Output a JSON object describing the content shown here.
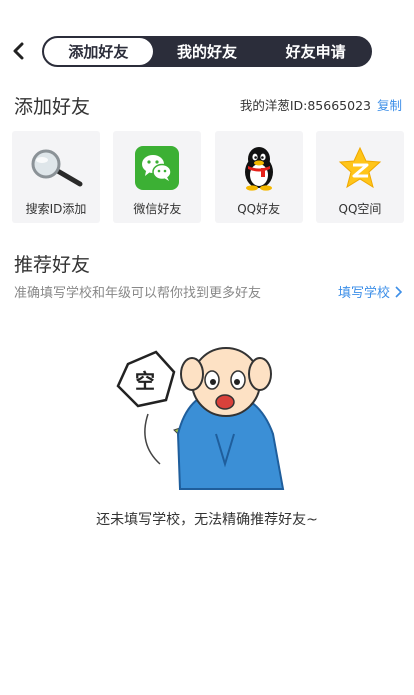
{
  "header": {
    "tabs": [
      {
        "label": "添加好友"
      },
      {
        "label": "我的好友"
      },
      {
        "label": "好友申请"
      }
    ]
  },
  "add_section": {
    "title": "添加好友",
    "my_id_text": "我的洋葱ID:85665023",
    "copy_label": "复制",
    "cards": [
      {
        "label": "搜索ID添加",
        "icon": "magnifier-icon"
      },
      {
        "label": "微信好友",
        "icon": "wechat-icon"
      },
      {
        "label": "QQ好友",
        "icon": "qq-penguin-icon"
      },
      {
        "label": "QQ空间",
        "icon": "qzone-star-icon"
      }
    ]
  },
  "recommend": {
    "title": "推荐好友",
    "subtitle": "准确填写学校和年级可以帮你找到更多好友",
    "link_label": "填写学校",
    "illustration_sign": "空",
    "empty_text": "还未填写学校，无法精确推荐好友~"
  },
  "colors": {
    "accent": "#3d8fe8",
    "tab_bar": "#2b2d3a",
    "card_bg": "#f4f4f6"
  }
}
